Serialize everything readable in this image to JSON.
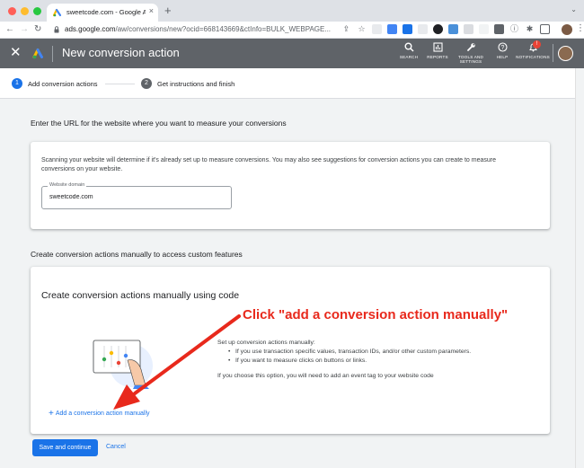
{
  "browser": {
    "tab_title": "sweetcode.com - Google Ads",
    "tab_close": "×",
    "new_tab": "+",
    "url_host": "ads.google.com",
    "url_path": "/aw/conversions/new?ocid=668143669&ctInfo=BULK_WEBPAGE..."
  },
  "app": {
    "close_glyph": "✕",
    "title": "New conversion action",
    "header_buttons": {
      "search": "SEARCH",
      "reports": "REPORTS",
      "tools_line1": "TOOLS AND",
      "tools_line2": "SETTINGS",
      "help": "HELP",
      "notifications": "NOTIFICATIONS"
    },
    "notif_count": "!"
  },
  "stepper": {
    "step1_num": "1",
    "step1_label": "Add conversion actions",
    "step2_num": "2",
    "step2_label": "Get instructions and finish"
  },
  "website_section": {
    "heading": "Enter the URL for the website where you want to measure your conversions",
    "description": "Scanning your website will determine if it's already set up to measure conversions. You may also see suggestions for conversion actions you can create to measure conversions on your website.",
    "field_label": "Website domain",
    "field_value": "sweetcode.com"
  },
  "manual_section": {
    "heading": "Create conversion actions manually to access custom features",
    "card_title": "Create conversion actions manually using code",
    "intro": "Set up conversion actions manually:",
    "bullets": [
      "If you use transaction specific values, transaction IDs, and/or other custom parameters.",
      "If you want to measure clicks on buttons or links."
    ],
    "note": "If you choose this option, you will need to add an event tag to your website code",
    "add_link": "Add a conversion action manually",
    "add_plus": "+"
  },
  "footer": {
    "save": "Save and continue",
    "cancel": "Cancel"
  },
  "annotation": {
    "text": "Click \"add a conversion action manually\"",
    "color": "#e8291c"
  },
  "colors": {
    "accent": "#1a73e8",
    "header_bg": "#5f6368"
  }
}
